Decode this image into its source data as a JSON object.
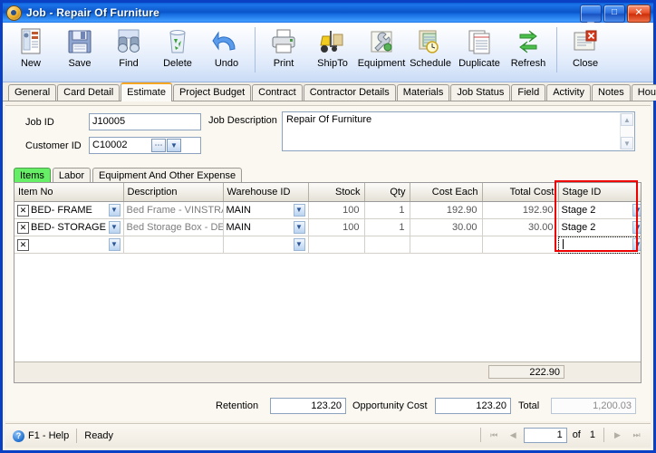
{
  "window": {
    "title": "Job - Repair Of Furniture",
    "controls": {
      "minimize": "_",
      "maximize": "□",
      "close": "✕"
    }
  },
  "toolbar": {
    "buttons": [
      {
        "label": "New",
        "icon": "new-document-icon"
      },
      {
        "label": "Save",
        "icon": "floppy-disk-icon"
      },
      {
        "label": "Find",
        "icon": "binoculars-icon"
      },
      {
        "label": "Delete",
        "icon": "recycle-bin-icon"
      },
      {
        "label": "Undo",
        "icon": "undo-arrow-icon"
      },
      {
        "label": "Print",
        "icon": "printer-icon"
      },
      {
        "label": "ShipTo",
        "icon": "forklift-icon"
      },
      {
        "label": "Equipment",
        "icon": "wrench-icon"
      },
      {
        "label": "Schedule",
        "icon": "schedule-clock-icon"
      },
      {
        "label": "Duplicate",
        "icon": "duplicate-pages-icon"
      },
      {
        "label": "Refresh",
        "icon": "refresh-arrows-icon"
      },
      {
        "label": "Close",
        "icon": "close-window-icon"
      }
    ]
  },
  "tabs": {
    "items": [
      "General",
      "Card Detail",
      "Estimate",
      "Project Budget",
      "Contract",
      "Contractor Details",
      "Materials",
      "Job Status",
      "Field",
      "Activity",
      "Notes",
      "Hours"
    ],
    "active": "Estimate"
  },
  "header": {
    "job_id_label": "Job ID",
    "job_id_value": "J10005",
    "customer_id_label": "Customer ID",
    "customer_id_value": "C10002",
    "lookup_button": "⋯",
    "dropdown_button": "▼",
    "job_description_label": "Job Description",
    "job_description_value": "Repair Of Furniture",
    "scroll_up": "▲",
    "scroll_down": "▼"
  },
  "subtabs": {
    "items": [
      "Items",
      "Labor",
      "Equipment And Other Expense"
    ],
    "active": "Items"
  },
  "grid": {
    "columns": [
      "Item No",
      "Description",
      "Warehouse ID",
      "Stock",
      "Qty",
      "Cost Each",
      "Total Cost",
      "Stage ID"
    ],
    "delete_row_button": "✕",
    "dropdown_button": "▼",
    "rows": [
      {
        "item_no": "BED- FRAME",
        "description": "Bed Frame - VINSTRA",
        "warehouse_id": "MAIN",
        "stock": "100",
        "qty": "1",
        "cost_each": "192.90",
        "total_cost": "192.90",
        "stage_id": "Stage 2"
      },
      {
        "item_no": "BED- STORAGE",
        "description": "Bed Storage Box - DE",
        "warehouse_id": "MAIN",
        "stock": "100",
        "qty": "1",
        "cost_each": "30.00",
        "total_cost": "30.00",
        "stage_id": "Stage 2"
      },
      {
        "item_no": "",
        "description": "",
        "warehouse_id": "",
        "stock": "",
        "qty": "",
        "cost_each": "",
        "total_cost": "",
        "stage_id": ""
      }
    ],
    "footer_total": "222.90",
    "highlight_color": "#ee0000",
    "highlighted_column": "Stage ID"
  },
  "totals": {
    "retention_label": "Retention",
    "retention_value": "123.20",
    "opportunity_cost_label": "Opportunity Cost",
    "opportunity_cost_value": "123.20",
    "total_label": "Total",
    "total_value": "1,200.03"
  },
  "statusbar": {
    "help_icon": "?",
    "help_text": "F1 - Help",
    "status_text": "Ready",
    "nav": {
      "first": "⏮",
      "prev": "◀",
      "page": "1",
      "of_label": "of",
      "count": "1",
      "next": "▶",
      "last": "⏭"
    }
  }
}
